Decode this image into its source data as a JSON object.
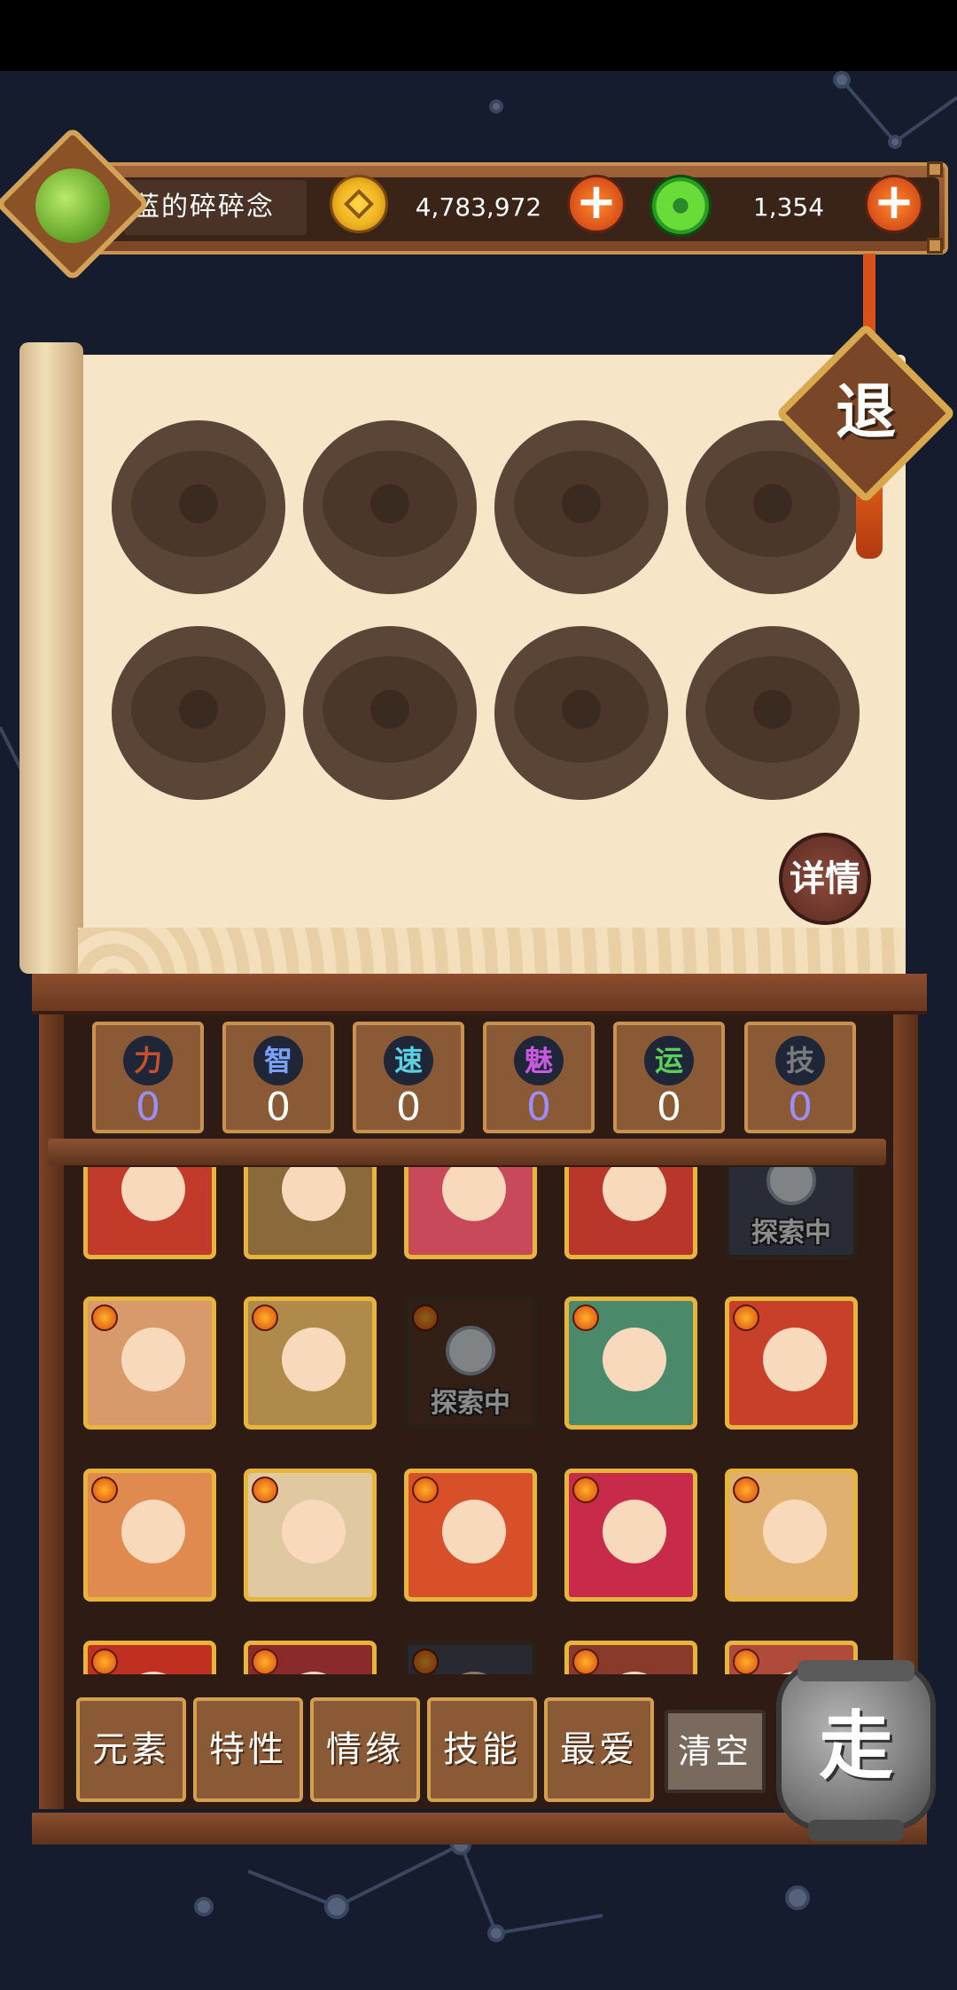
{
  "player": {
    "name": "蓝的碎碎念"
  },
  "currency": {
    "gold": "4,783,972",
    "jade": "1,354",
    "add_symbol": "+"
  },
  "exit_label": "退",
  "detail_label": "详情",
  "stats": [
    {
      "icon": "力",
      "value": "0",
      "color": "#c8502a",
      "value_color": "#9b8cff"
    },
    {
      "icon": "智",
      "value": "0",
      "color": "#7aa0ff",
      "value_color": "#ffffff"
    },
    {
      "icon": "速",
      "value": "0",
      "color": "#5ad0e0",
      "value_color": "#ffffff"
    },
    {
      "icon": "魅",
      "value": "0",
      "color": "#c85ae0",
      "value_color": "#9b8cff"
    },
    {
      "icon": "运",
      "value": "0",
      "color": "#5ad05a",
      "value_color": "#ffffff"
    },
    {
      "icon": "技",
      "value": "0",
      "color": "#7a7a7a",
      "value_color": "#9b8cff"
    }
  ],
  "heroes": [
    {
      "label": "",
      "bg": "#c23a2a",
      "dim": false
    },
    {
      "label": "",
      "bg": "#8a6a3a",
      "dim": false
    },
    {
      "label": "",
      "bg": "#c84a5a",
      "dim": false
    },
    {
      "label": "",
      "bg": "#b8362a",
      "dim": false
    },
    {
      "label": "探索中",
      "bg": "#4a5060",
      "dim": true
    },
    {
      "label": "",
      "bg": "#d89a6a",
      "dim": false
    },
    {
      "label": "",
      "bg": "#b08a4a",
      "dim": false
    },
    {
      "label": "探索中",
      "bg": "#5a3a2a",
      "dim": true
    },
    {
      "label": "",
      "bg": "#4a8a6a",
      "dim": false
    },
    {
      "label": "",
      "bg": "#c8402a",
      "dim": false
    },
    {
      "label": "",
      "bg": "#e08a50",
      "dim": false
    },
    {
      "label": "",
      "bg": "#e0c8a0",
      "dim": false
    },
    {
      "label": "",
      "bg": "#d8502a",
      "dim": false
    },
    {
      "label": "",
      "bg": "#c82a4a",
      "dim": false
    },
    {
      "label": "",
      "bg": "#e0b070",
      "dim": false
    },
    {
      "label": "",
      "bg": "#c03020",
      "dim": false
    },
    {
      "label": "",
      "bg": "#8a2a2a",
      "dim": false
    },
    {
      "label": "",
      "bg": "#4a4a5a",
      "dim": true
    },
    {
      "label": "",
      "bg": "#8a3a2a",
      "dim": false
    },
    {
      "label": "",
      "bg": "#b04a3a",
      "dim": false
    }
  ],
  "filters": [
    "元素",
    "特性",
    "情缘",
    "技能",
    "最爱"
  ],
  "clear_label": "清空",
  "go_label": "走"
}
